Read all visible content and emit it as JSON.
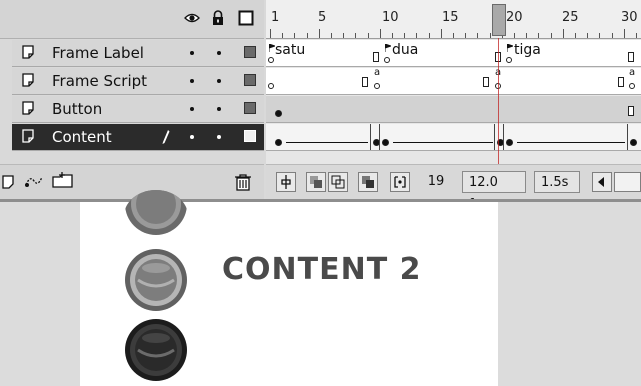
{
  "timeline": {
    "header_icons": [
      "eye-icon",
      "lock-icon",
      "outline-square-icon"
    ],
    "ruler": {
      "labels": [
        "1",
        "5",
        "10",
        "15",
        "20",
        "25",
        "30"
      ]
    },
    "layers": [
      {
        "name": "Frame Label",
        "icon": "layer-page-icon"
      },
      {
        "name": "Frame Script",
        "icon": "layer-page-icon"
      },
      {
        "name": "Button",
        "icon": "layer-page-icon"
      },
      {
        "name": "Content",
        "icon": "layer-page-icon",
        "selected": true,
        "extra_icon": "pencil-icon"
      }
    ],
    "frame_labels": [
      "satu",
      "dua",
      "tiga"
    ],
    "frame_script_markers": [
      "a",
      "a",
      "a"
    ],
    "bottom_toolbar_icons": [
      "insert-layer-icon",
      "add-motion-guide-icon",
      "insert-layer-folder-icon",
      "delete-layer-icon"
    ],
    "status": {
      "current_frame": "19",
      "frame_rate": "12.0 fps",
      "elapsed_time": "1.5s",
      "buttons": [
        "center-frame-icon",
        "onion-skin-icon",
        "onion-skin-outlines-icon",
        "edit-multiple-frames-icon",
        "modify-onion-markers-icon"
      ]
    },
    "playhead_frame": 20
  },
  "stage": {
    "title": "CONTENT 2",
    "buttons": [
      "button-top-icon",
      "button-middle-icon",
      "button-bottom-icon"
    ]
  },
  "colors": {
    "timeline_bg": "#d9d9d9",
    "selected_layer_bg": "#2b2b2b",
    "stage_bg": "#ffffff",
    "text_dark": "#4a4a4a"
  }
}
